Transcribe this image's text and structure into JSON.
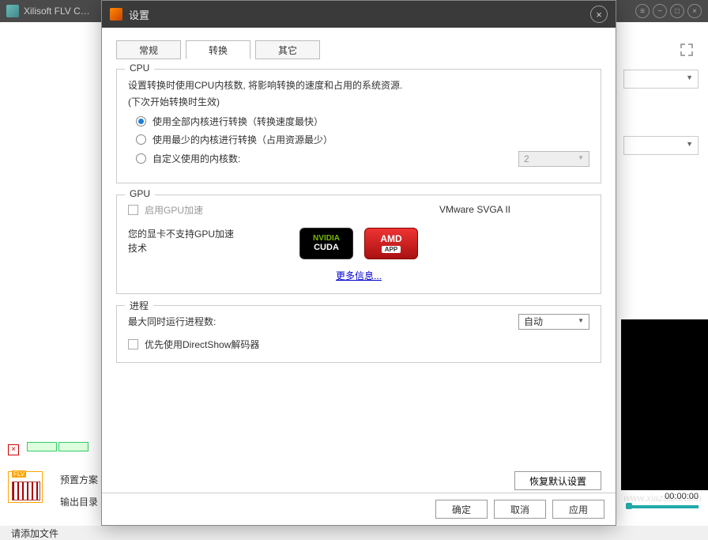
{
  "app": {
    "title": "Xilisoft FLV C…"
  },
  "win_controls": {
    "menu": "≡",
    "min": "−",
    "max": "□",
    "close": "×"
  },
  "video": {
    "time": "00:00:00"
  },
  "bottom": {
    "preset": "预置方案",
    "output": "输出目录",
    "add_file": "请添加文件"
  },
  "dialog": {
    "title": "设置",
    "close": "×",
    "tabs": {
      "general": "常规",
      "convert": "转换",
      "other": "其它"
    },
    "cpu": {
      "legend": "CPU",
      "desc": "设置转换时使用CPU内核数, 将影响转换的速度和占用的系统资源.",
      "note": "(下次开始转换时生效)",
      "opt_all": "使用全部内核进行转换（转换速度最快）",
      "opt_min": "使用最少的内核进行转换（占用资源最少）",
      "opt_custom": "自定义使用的内核数:",
      "core_value": "2"
    },
    "gpu": {
      "legend": "GPU",
      "enable": "启用GPU加速",
      "device": "VMware SVGA II",
      "unsupported": "您的显卡不支持GPU加速技术",
      "nvidia": "NVIDIA",
      "cuda": "CUDA",
      "amd": "AMD",
      "app": "APP",
      "more": "更多信息..."
    },
    "process": {
      "legend": "进程",
      "max_label": "最大同时运行进程数:",
      "max_value": "自动",
      "directshow": "优先使用DirectShow解码器"
    },
    "restore": "恢复默认设置",
    "ok": "确定",
    "cancel": "取消",
    "apply": "应用"
  },
  "watermark": "www.xiazaiba.com"
}
